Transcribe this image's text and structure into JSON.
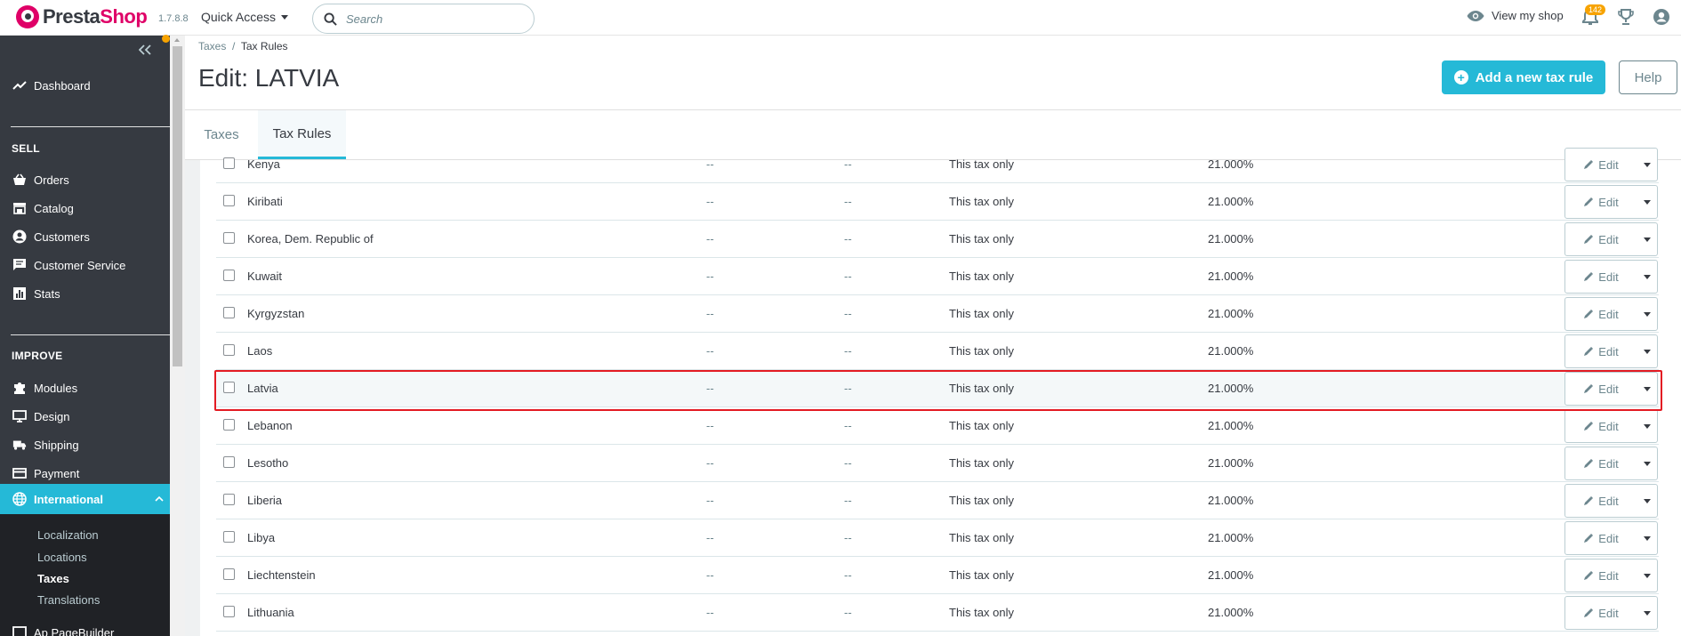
{
  "header": {
    "logo_presta": "Presta",
    "logo_shop": "Shop",
    "version": "1.7.8.8",
    "quick_access": "Quick Access",
    "search_placeholder": "Search",
    "view_shop": "View my shop",
    "notification_count": "142"
  },
  "sidebar": {
    "dashboard": "Dashboard",
    "sell_title": "SELL",
    "sell_items": [
      "Orders",
      "Catalog",
      "Customers",
      "Customer Service",
      "Stats"
    ],
    "improve_title": "IMPROVE",
    "improve_items": [
      "Modules",
      "Design",
      "Shipping",
      "Payment",
      "International"
    ],
    "international_sub": [
      "Localization",
      "Locations",
      "Taxes",
      "Translations"
    ],
    "partial_item": "Ap PageBuilder"
  },
  "page": {
    "breadcrumb_parent": "Taxes",
    "breadcrumb_sep": "/",
    "breadcrumb_current": "Tax Rules",
    "title": "Edit: LATVIA",
    "add_button": "Add a new tax rule",
    "help_button": "Help",
    "tabs": [
      "Taxes",
      "Tax Rules"
    ]
  },
  "table": {
    "edit_label": "Edit",
    "rows": [
      {
        "country": "Kenya",
        "zip": "--",
        "description": "--",
        "behavior": "This tax only",
        "tax": "21.000%"
      },
      {
        "country": "Kiribati",
        "zip": "--",
        "description": "--",
        "behavior": "This tax only",
        "tax": "21.000%"
      },
      {
        "country": "Korea, Dem. Republic of",
        "zip": "--",
        "description": "--",
        "behavior": "This tax only",
        "tax": "21.000%"
      },
      {
        "country": "Kuwait",
        "zip": "--",
        "description": "--",
        "behavior": "This tax only",
        "tax": "21.000%"
      },
      {
        "country": "Kyrgyzstan",
        "zip": "--",
        "description": "--",
        "behavior": "This tax only",
        "tax": "21.000%"
      },
      {
        "country": "Laos",
        "zip": "--",
        "description": "--",
        "behavior": "This tax only",
        "tax": "21.000%"
      },
      {
        "country": "Latvia",
        "zip": "--",
        "description": "--",
        "behavior": "This tax only",
        "tax": "21.000%"
      },
      {
        "country": "Lebanon",
        "zip": "--",
        "description": "--",
        "behavior": "This tax only",
        "tax": "21.000%"
      },
      {
        "country": "Lesotho",
        "zip": "--",
        "description": "--",
        "behavior": "This tax only",
        "tax": "21.000%"
      },
      {
        "country": "Liberia",
        "zip": "--",
        "description": "--",
        "behavior": "This tax only",
        "tax": "21.000%"
      },
      {
        "country": "Libya",
        "zip": "--",
        "description": "--",
        "behavior": "This tax only",
        "tax": "21.000%"
      },
      {
        "country": "Liechtenstein",
        "zip": "--",
        "description": "--",
        "behavior": "This tax only",
        "tax": "21.000%"
      },
      {
        "country": "Lithuania",
        "zip": "--",
        "description": "--",
        "behavior": "This tax only",
        "tax": "21.000%"
      }
    ]
  },
  "colors": {
    "accent": "#25b9d7",
    "brand": "#df0067",
    "sidebar": "#363a41",
    "highlight": "#e31b23",
    "badge": "#f7a300"
  }
}
